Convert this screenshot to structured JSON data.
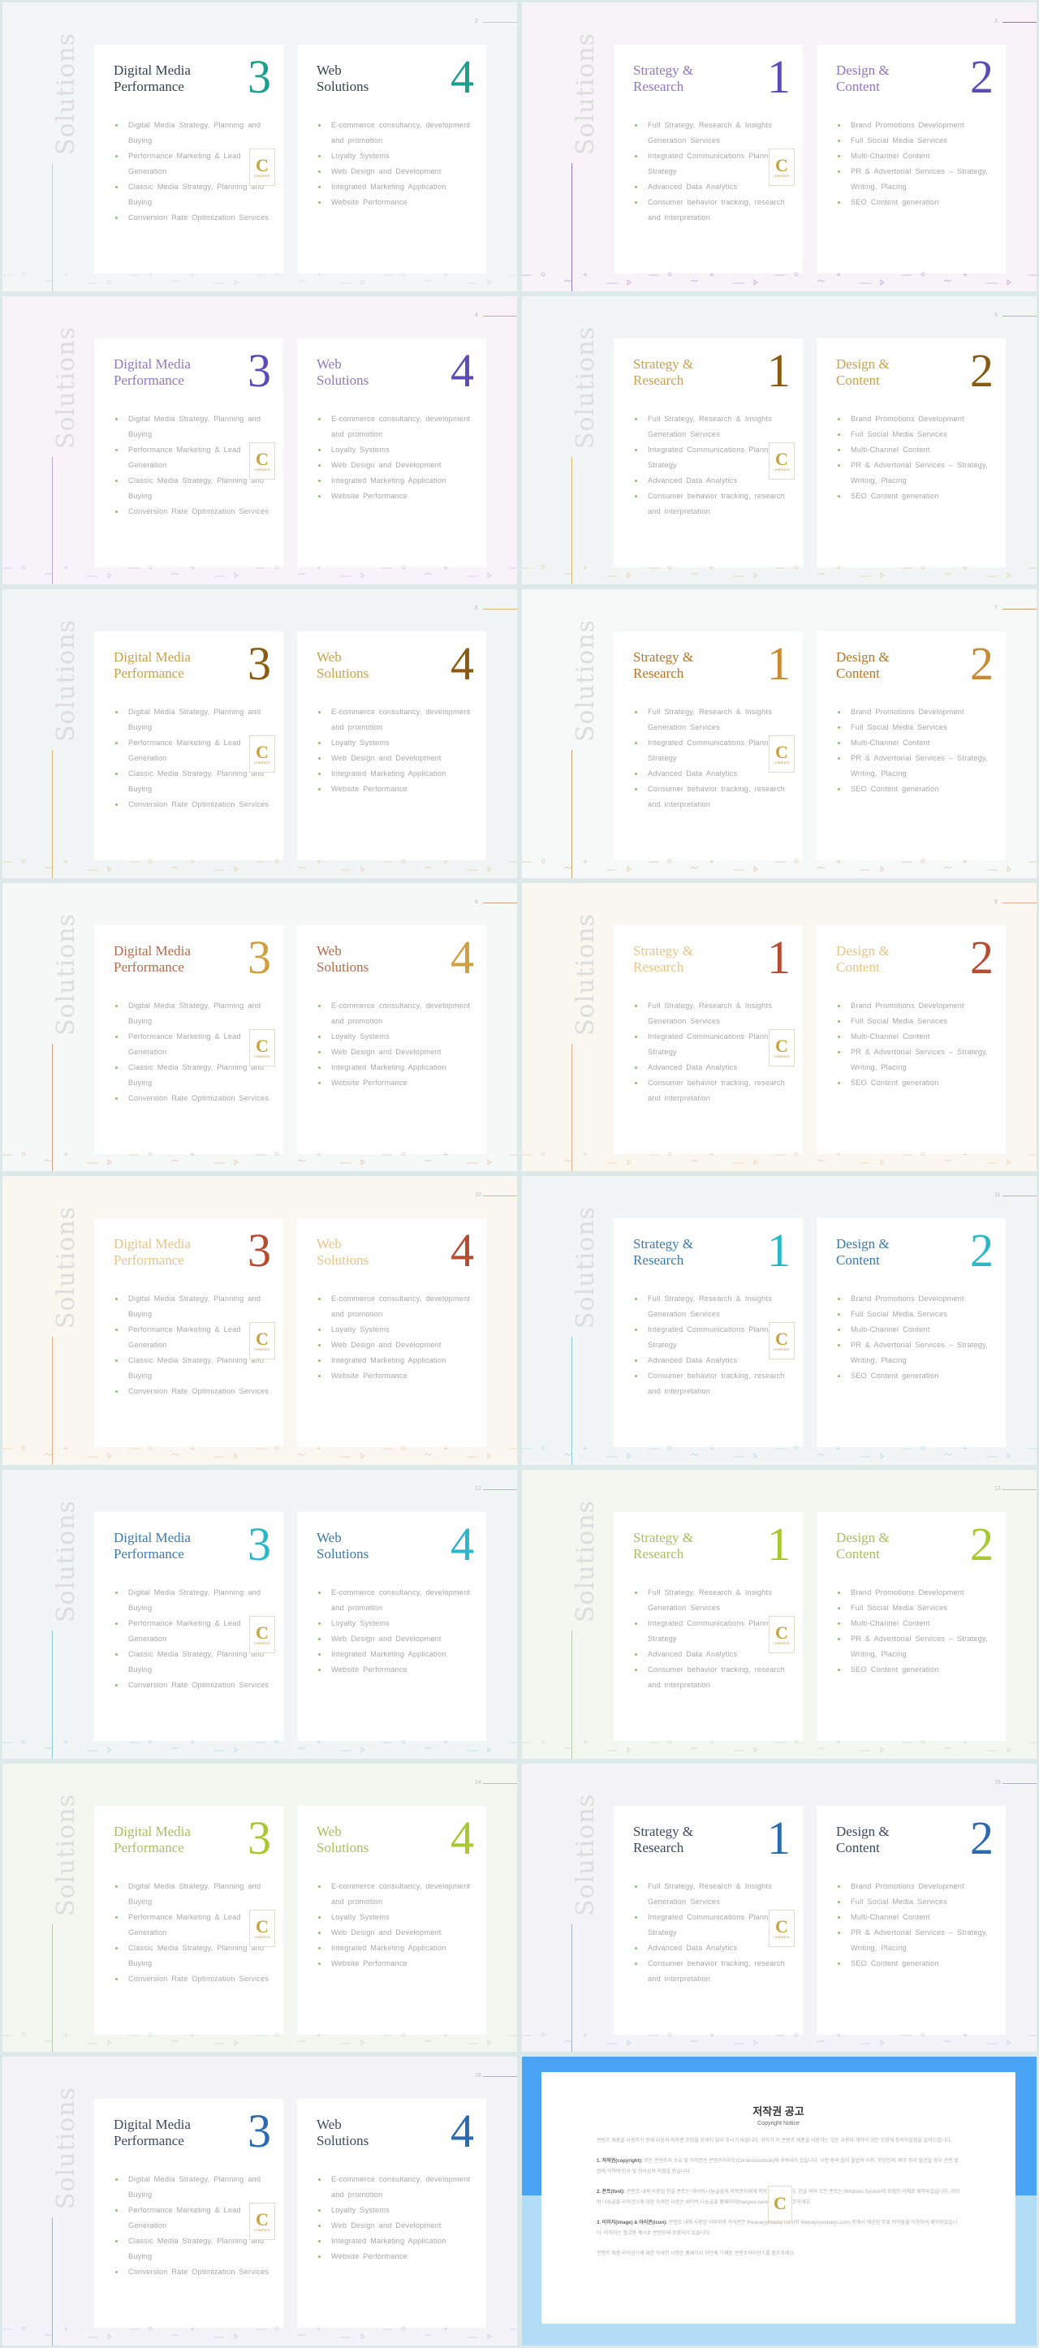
{
  "side_title": "Solutions",
  "logo": {
    "letter": "C",
    "text": "CONTENTS"
  },
  "content": {
    "A": {
      "cards": [
        {
          "title": "Digital Media\nPerformance",
          "number": "3",
          "bullets": [
            "Digital Media Strategy, Planning and Buying",
            "Performance Marketing & Lead Generation",
            "Classic Media Strategy, Planning and Buying",
            "Conversion Rate Optimization Services"
          ]
        },
        {
          "title": "Web\nSolutions",
          "number": "4",
          "bullets": [
            "E-commerce consultancy, development and promotion",
            "Loyalty Systems",
            "Web Design and Development",
            "Integrated Marketing Application",
            "Website Performance"
          ]
        }
      ]
    },
    "B": {
      "cards": [
        {
          "title": "Strategy &\nResearch",
          "number": "1",
          "bullets": [
            "Full Strategy, Research & Insights Generation Services",
            "Integrated Communications Planning & Strategy",
            "Advanced Data Analytics",
            "Consumer behavior tracking, research and interpretation"
          ]
        },
        {
          "title": "Design &\nContent",
          "number": "2",
          "bullets": [
            "Brand Promotions Development",
            "Full Social Media Services",
            "Multi-Channel Content",
            "PR & Advertorial Services – Strategy, Writing, Placing",
            "SEO Content generation"
          ]
        }
      ]
    }
  },
  "slides": [
    {
      "page": "2",
      "variant": "A",
      "bg": "#f3f6f6",
      "title_color": "#34434a",
      "number_color": "#1a9e8e",
      "accent": "#c8cfd0"
    },
    {
      "page": "3",
      "variant": "B",
      "bg": "#f8f3f8",
      "title_color": "#8f78c4",
      "number_color": "#5b4bb8",
      "accent": "#8f78c4"
    },
    {
      "page": "4",
      "variant": "A",
      "bg": "#f8f3f8",
      "title_color": "#8f78c4",
      "number_color": "#5b4bb8",
      "accent": "#b8a8d8"
    },
    {
      "page": "5",
      "variant": "B",
      "bg": "#f1f5f5",
      "title_color": "#c9a24a",
      "number_color": "#8a5a10",
      "accent": "#d8b870"
    },
    {
      "page": "6",
      "variant": "A",
      "bg": "#f1f5f5",
      "title_color": "#c9a24a",
      "number_color": "#8a5a10",
      "accent": "#d8b870"
    },
    {
      "page": "7",
      "variant": "B",
      "bg": "#f7f9f9",
      "title_color": "#b8742a",
      "number_color": "#c98a30",
      "accent": "#c9a070"
    },
    {
      "page": "8",
      "variant": "A",
      "bg": "#f6f8f8",
      "title_color": "#b56a4a",
      "number_color": "#d0a040",
      "accent": "#d0a080"
    },
    {
      "page": "9",
      "variant": "B",
      "bg": "#faf7f0",
      "title_color": "#e8c488",
      "number_color": "#b84a30",
      "accent": "#e0b090"
    },
    {
      "page": "10",
      "variant": "A",
      "bg": "#faf7f0",
      "title_color": "#e8c488",
      "number_color": "#b84a30",
      "accent": "#e0b090"
    },
    {
      "page": "11",
      "variant": "B",
      "bg": "#f1f5f6",
      "title_color": "#3a7ab0",
      "number_color": "#29b8c8",
      "accent": "#8cc8d8"
    },
    {
      "page": "12",
      "variant": "A",
      "bg": "#f1f5f6",
      "title_color": "#3a7ab0",
      "number_color": "#29b8c8",
      "accent": "#8cc8d8"
    },
    {
      "page": "13",
      "variant": "B",
      "bg": "#f3f7f0",
      "title_color": "#a8c060",
      "number_color": "#a8c830",
      "accent": "#b8c8b0"
    },
    {
      "page": "14",
      "variant": "A",
      "bg": "#f3f7f0",
      "title_color": "#a8c060",
      "number_color": "#a8c830",
      "accent": "#b8c8b0"
    },
    {
      "page": "15",
      "variant": "B",
      "bg": "#f4f4f8",
      "title_color": "#3a4a60",
      "number_color": "#2a6ab0",
      "accent": "#a8b0c8"
    },
    {
      "page": "16",
      "variant": "A",
      "bg": "#f4f4f8",
      "title_color": "#3a4a60",
      "number_color": "#2a6ab0",
      "accent": "#a8b0c8"
    }
  ],
  "copyright": {
    "title": "저작권 공고",
    "subtitle": "Copyright Notice",
    "intro": "콘텐츠 제품을 사용하기 전에 다음의 저작권 조항을 자세히 읽어 주시기 바랍니다. 귀하가 이 콘텐츠 제품을 사용하는 것은 사용자 계약의 모든 조항에 동의하였음을 알려드립니다.",
    "sections": [
      {
        "label": "1. 저작권(copyright):",
        "text": "모든 콘텐츠의 소유 및 저작권은 콘텐츠아이오(Contentsoutlook)에 귀속되어 있습니다. 사전 동의 없이 불법적 이용, 무단전재, 배포 등이 발견될 경우 관련 법령에 의하여 민사 및 형사상의 처벌을 받습니다."
      },
      {
        "label": "2. 폰트(font):",
        "text": "콘텐츠 내에 사용된 한글 폰트는 네이버 나눔글꼴의 저작권자에게 저작권이 있습니다. 한글 외의 모든 폰트는 Windows System에 포함된 서체로 제작되었습니다. 네이버 나눔글꼴 라이선스에 대한 자세한 사항은 네이버 나눔글꼴 홈페이지(hangeul.naver.com)를 참조하세요."
      },
      {
        "label": "3. 이미지(image) & 아이콘(icon):",
        "text": "콘텐츠 내에 사용된 이미지와 아이콘은 Pixabay(pixabay.com)와 Webalys(webalys.com) 등에서 제공된 무료 저작물을 이용하여 제작되었습니다. 이미지는 참고용 예시로 콘텐츠에 포함되어 있습니다."
      }
    ],
    "outro": "콘텐츠 제품 라이선스에 대한 자세한 사항은 홈페이지 하단에 기재된 콘텐츠라이선스를 참조하세요."
  }
}
